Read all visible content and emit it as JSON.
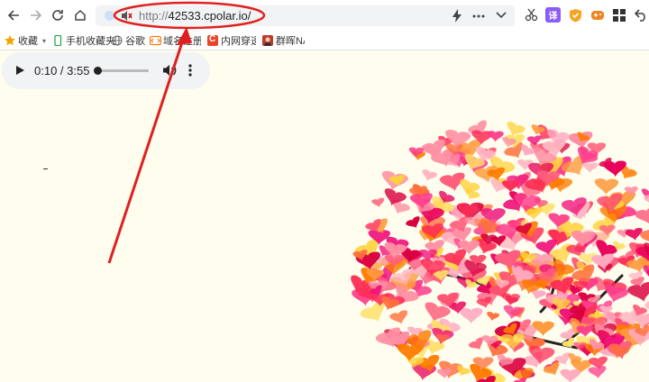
{
  "browser": {
    "address": {
      "protocol": "http://",
      "host": "42533.cpolar.io/"
    },
    "nav_icons": [
      "back-icon",
      "forward-icon",
      "reload-icon",
      "home-icon"
    ],
    "address_icons": [
      "lightning-icon",
      "more-icon",
      "chevron-down-icon"
    ],
    "extension_icons": [
      "scissors-icon",
      "translate-icon",
      "shield-icon",
      "gamepad-icon",
      "grid-icon",
      "undo-icon"
    ]
  },
  "bookmarks": {
    "items": [
      {
        "label": "收藏",
        "icon": "star-icon"
      },
      {
        "label": "手机收藏夹",
        "icon": "phone-icon"
      },
      {
        "label": "谷歌",
        "icon": "globe-icon"
      },
      {
        "label": "域名注册",
        "icon": "domain-icon"
      },
      {
        "label": "内网穿透",
        "icon": "cpolar-icon"
      },
      {
        "label": "群晖NAS",
        "icon": "avatar-icon"
      }
    ]
  },
  "player": {
    "time": "0:10 / 3:55",
    "progress_fraction": 0.0426
  },
  "annotation": {
    "color": "#e02020"
  },
  "colors": {
    "page_background": "#fffeee",
    "player_background": "#f1f3f4",
    "url_bar_background": "#f1f3f4"
  }
}
